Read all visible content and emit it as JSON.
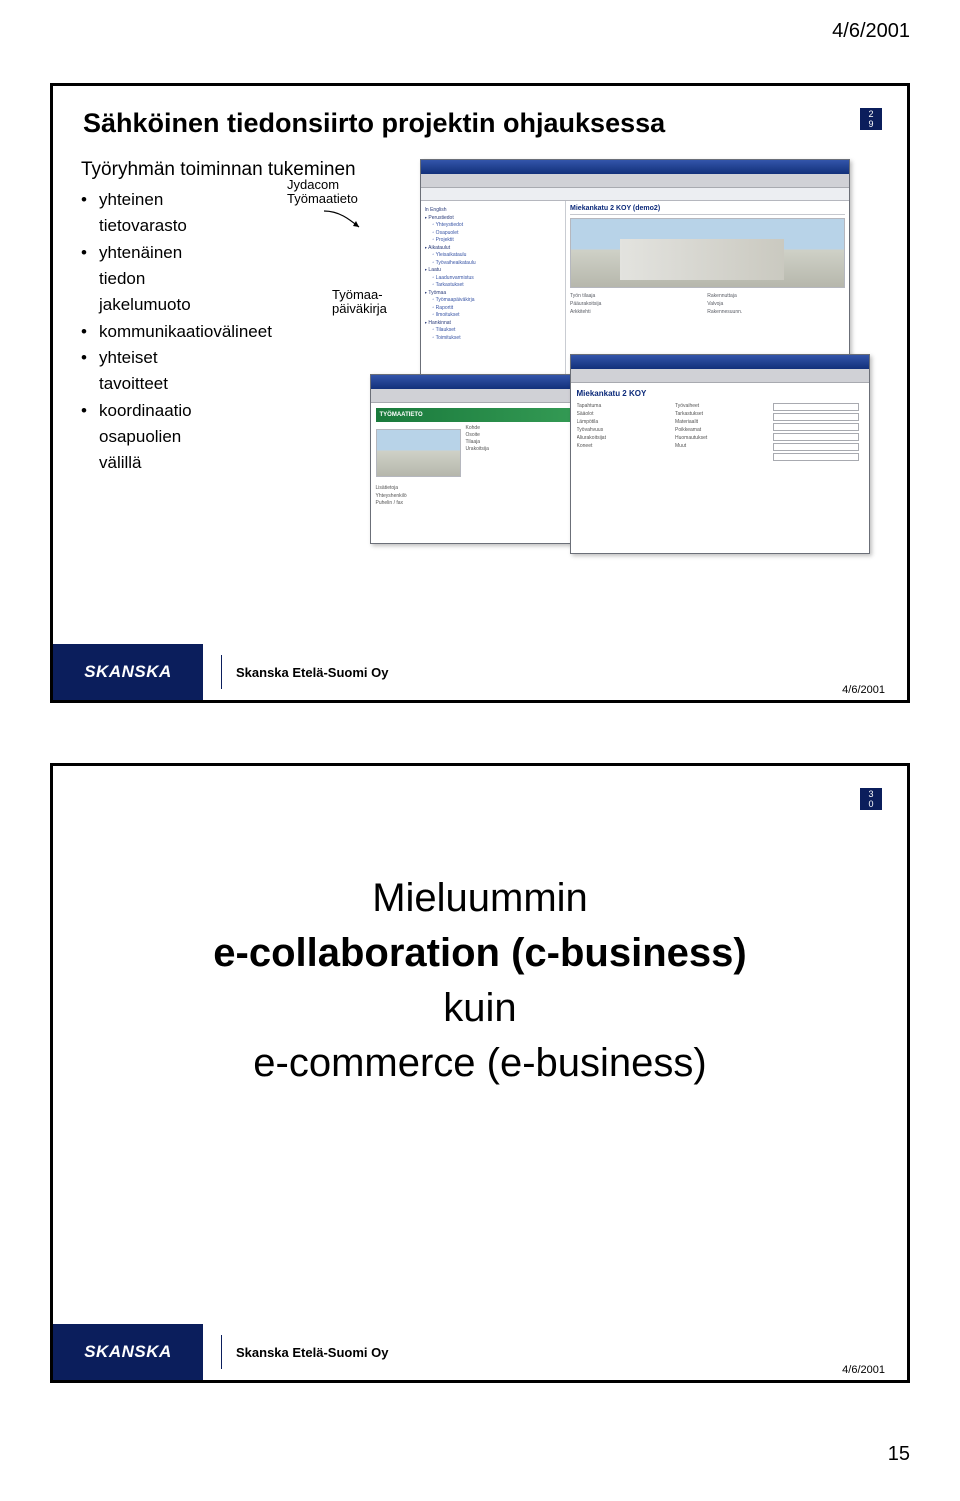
{
  "header_date": "4/6/2001",
  "slide1": {
    "title": "Sähköinen tiedonsiirto projektin ohjauksessa",
    "num_top": "2",
    "num_bottom": "9",
    "subtitle": "Työryhmän toiminnan tukeminen",
    "bullets": [
      "yhteinen tietovarasto",
      "yhtenäinen tiedon jakelumuoto",
      "kommunikaatiovälineet",
      "yhteiset tavoitteet",
      "koordinaatio osapuolien välillä"
    ],
    "label1_line1": "Jydacom",
    "label1_line2": "Työmaatieto",
    "label2_line1": "Työmaa-",
    "label2_line2": "päiväkirja",
    "screenshot_main_header": "Miekankatu 2 KOY (demo2)",
    "screenshot2_green": "TYÖMAATIETO",
    "screenshot3_header": "Miekankatu 2 KOY"
  },
  "slide2": {
    "num_top": "3",
    "num_bottom": "0",
    "line1": "Mieluummin",
    "line2": "e-collaboration (c-business)",
    "line3": "kuin",
    "line4": "e-commerce (e-business)"
  },
  "footer": {
    "logo": "SKANSKA",
    "company": "Skanska Etelä-Suomi Oy",
    "date": "4/6/2001"
  },
  "page_number": "15"
}
